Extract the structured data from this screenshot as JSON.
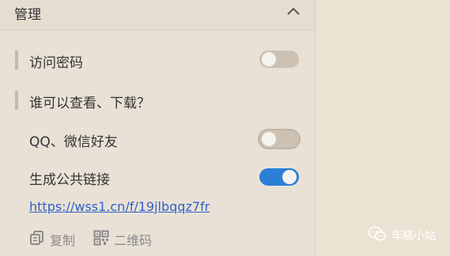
{
  "panel": {
    "title": "管理",
    "collapse_icon": "chevron-up-icon"
  },
  "settings": {
    "access_password": {
      "label": "访问密码",
      "enabled": false
    },
    "who_can_view_download": {
      "label": "谁可以查看、下载？"
    },
    "qq_wechat_friends": {
      "label": "QQ、微信好友",
      "enabled": false
    },
    "generate_public_link": {
      "label": "生成公共链接",
      "enabled": true
    }
  },
  "public_link": {
    "url": "https://wss1.cn/f/19jlbqqz7fr"
  },
  "actions": {
    "copy": {
      "label": "复制",
      "icon": "copy-icon"
    },
    "qrcode": {
      "label": "二维码",
      "icon": "qrcode-icon"
    }
  },
  "watermark": {
    "label": "年糕小站",
    "icon": "wechat-icon"
  },
  "colors": {
    "toggle_on": "#2b7fd7",
    "toggle_off": "#cdc1b1",
    "link": "#2e63c8",
    "accent_bar": "#c7b9a7"
  }
}
